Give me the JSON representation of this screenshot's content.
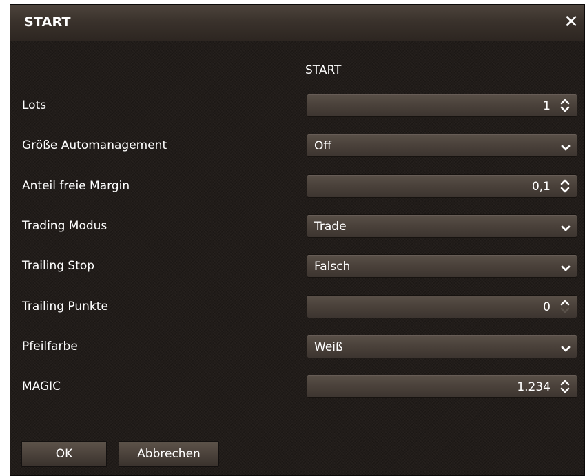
{
  "dialog": {
    "title": "START",
    "close_glyph": "✕",
    "section_header": "START"
  },
  "fields": [
    {
      "label": "Lots",
      "value": "1",
      "kind": "spin"
    },
    {
      "label": "Größe Automanagement",
      "value": "Off",
      "kind": "select"
    },
    {
      "label": "Anteil freie Margin",
      "value": "0,1",
      "kind": "spin"
    },
    {
      "label": "Trading Modus",
      "value": "Trade",
      "kind": "select"
    },
    {
      "label": "Trailing Stop",
      "value": "Falsch",
      "kind": "select"
    },
    {
      "label": "Trailing Punkte",
      "value": "0",
      "kind": "spin-up"
    },
    {
      "label": "Pfeilfarbe",
      "value": "Weiß",
      "kind": "select"
    },
    {
      "label": "MAGIC",
      "value": "1.234",
      "kind": "spin"
    }
  ],
  "buttons": {
    "ok": "OK",
    "cancel": "Abbrechen"
  },
  "icons": {
    "close": "close-icon",
    "spin": "spin-arrows-icon",
    "dropdown": "chevron-down-icon"
  },
  "colors": {
    "background": "#211c19",
    "text": "#ffffff",
    "field": "#4a413a"
  }
}
